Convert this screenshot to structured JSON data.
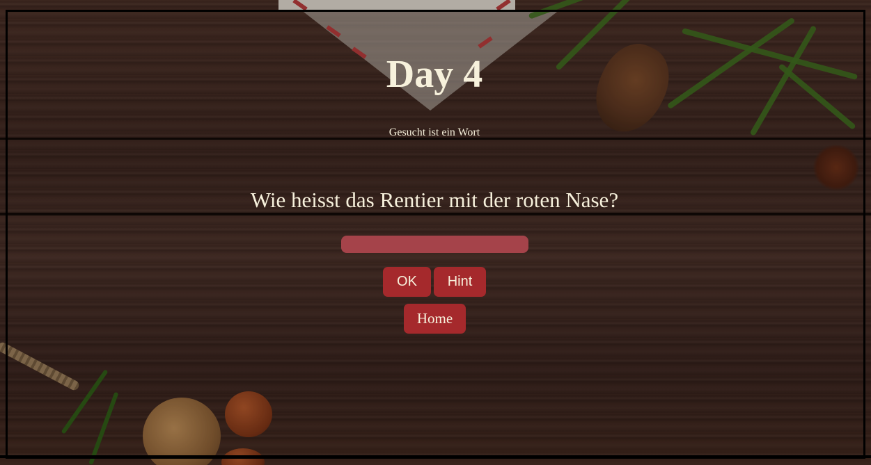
{
  "page": {
    "title": "Day 4",
    "subtitle": "Gesucht ist ein Wort",
    "question": "Wie heisst das Rentier mit der roten Nase?"
  },
  "answer": {
    "value": "",
    "placeholder": ""
  },
  "buttons": {
    "ok_label": "OK",
    "hint_label": "Hint",
    "home_label": "Home"
  },
  "colors": {
    "text": "#f7f1dc",
    "button": "#a5292c",
    "input": "#a5434a",
    "frame": "#000000"
  }
}
